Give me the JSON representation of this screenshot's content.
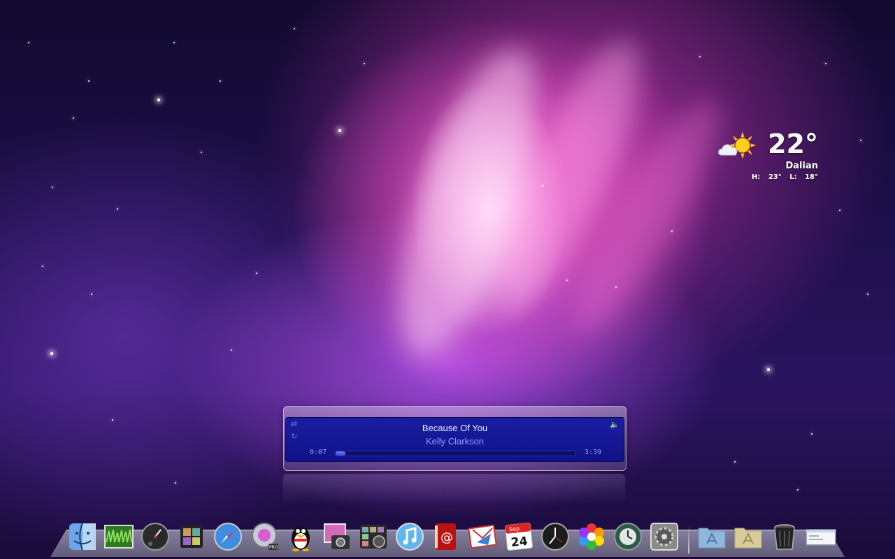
{
  "weather": {
    "temperature": "22°",
    "city": "Dalian",
    "high_low": "H: 23°  L: 18°",
    "condition_icon": "partly-cloudy-icon"
  },
  "music_player": {
    "song_title": "Because Of You",
    "artist": "Kelly Clarkson",
    "elapsed": "0:07",
    "duration": "3:39",
    "progress_percent": 4,
    "screen_color": "#1a1da0"
  },
  "dock": {
    "calendar_month": "Sep",
    "calendar_day": "24",
    "items": [
      "finder-icon",
      "grass-photo-icon",
      "dashboard-icon",
      "photo-booth-icon",
      "safari-icon",
      "quicktime-pro-icon",
      "qq-penguin-icon",
      "iphoto-icon",
      "photo-gallery-icon",
      "itunes-icon",
      "address-book-icon",
      "mail-icon",
      "calendar-icon",
      "clock-icon",
      "color-picker-icon",
      "time-machine-icon",
      "system-preferences-icon",
      "applications-folder-icon",
      "documents-folder-icon",
      "trash-icon",
      "window-icon"
    ]
  }
}
